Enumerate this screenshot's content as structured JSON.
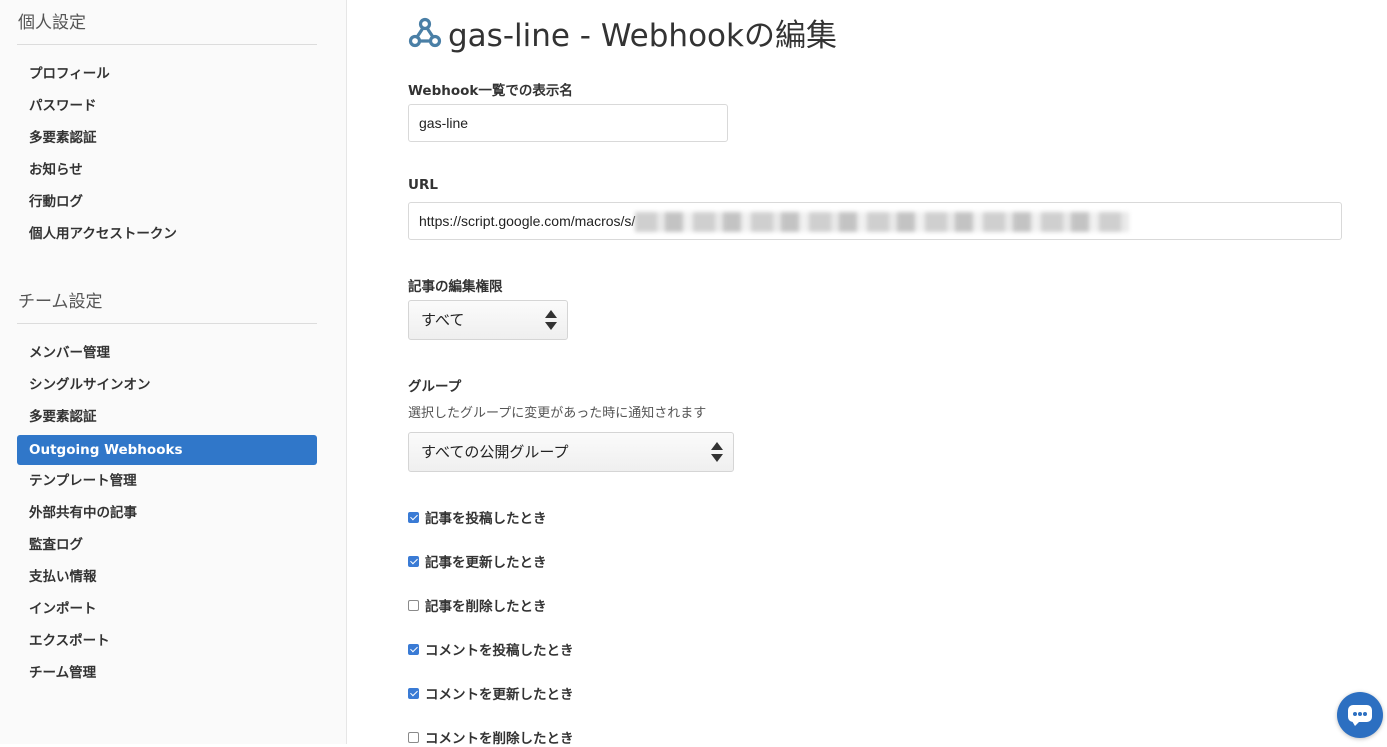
{
  "sidebar": {
    "personal_title": "個人設定",
    "personal_items": [
      {
        "label": "プロフィール"
      },
      {
        "label": "パスワード"
      },
      {
        "label": "多要素認証"
      },
      {
        "label": "お知らせ"
      },
      {
        "label": "行動ログ"
      },
      {
        "label": "個人用アクセストークン"
      }
    ],
    "team_title": "チーム設定",
    "team_items": [
      {
        "label": "メンバー管理"
      },
      {
        "label": "シングルサインオン"
      },
      {
        "label": "多要素認証"
      },
      {
        "label": "Outgoing Webhooks",
        "active": true
      },
      {
        "label": "テンプレート管理"
      },
      {
        "label": "外部共有中の記事"
      },
      {
        "label": "監査ログ"
      },
      {
        "label": "支払い情報"
      },
      {
        "label": "インポート"
      },
      {
        "label": "エクスポート"
      },
      {
        "label": "チーム管理"
      }
    ]
  },
  "main": {
    "title_icon": "webhook-icon",
    "title": "gas-line - Webhookの編集",
    "name_field": {
      "label": "Webhook一覧での表示名",
      "value": "gas-line"
    },
    "url_field": {
      "label": "URL",
      "value": "https://script.google.com/macros/s/"
    },
    "permission": {
      "label": "記事の編集権限",
      "selected": "すべて"
    },
    "group": {
      "label": "グループ",
      "help": "選択したグループに変更があった時に通知されます",
      "selected": "すべての公開グループ"
    },
    "events": [
      {
        "label": "記事を投稿したとき",
        "checked": true
      },
      {
        "label": "記事を更新したとき",
        "checked": true
      },
      {
        "label": "記事を削除したとき",
        "checked": false
      },
      {
        "label": "コメントを投稿したとき",
        "checked": true
      },
      {
        "label": "コメントを更新したとき",
        "checked": true
      },
      {
        "label": "コメントを削除したとき",
        "checked": false
      }
    ]
  },
  "chat_button": {
    "icon": "chat-icon"
  },
  "colors": {
    "accent": "#3077c9",
    "checkbox": "#3a7bd5",
    "chat": "#2c6fc1"
  }
}
